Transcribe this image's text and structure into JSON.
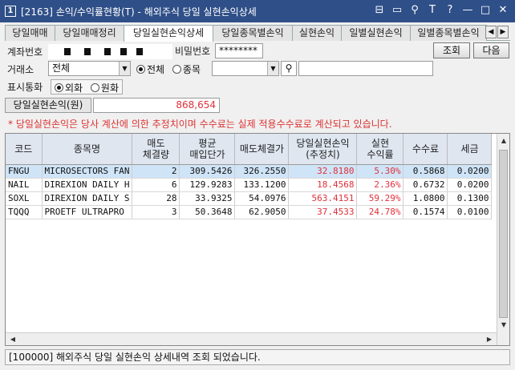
{
  "window": {
    "icon_label": "1",
    "title": "[2163] 손익/수익률현황(T) - 해외주식 당일 실현손익상세",
    "controls": [
      "⊟",
      "▭",
      "⚲",
      "T",
      "?",
      "—",
      "□",
      "✕"
    ]
  },
  "tabs": [
    {
      "label": "당일매매",
      "active": false
    },
    {
      "label": "당일매매정리",
      "active": false
    },
    {
      "label": "당일실현손익상세",
      "active": true
    },
    {
      "label": "당일종목별손익",
      "active": false
    },
    {
      "label": "실현손익",
      "active": false
    },
    {
      "label": "일별실현손익",
      "active": false
    },
    {
      "label": "일별종목별손익",
      "active": false
    }
  ],
  "form": {
    "account_label": "계좌번호",
    "password_label": "비밀번호",
    "password_value": "********",
    "query_button": "조회",
    "next_button": "다음",
    "exchange_label": "거래소",
    "exchange_value": "전체",
    "scope_all": "전체",
    "scope_item": "종목",
    "currency_label": "표시통화",
    "currency_foreign": "외화",
    "currency_won": "원화"
  },
  "summary": {
    "label": "당일실현손익(원)",
    "value": "868,654"
  },
  "notice": "* 당일실현손익은 당사 계산에 의한 추정치이며 수수료는 실제 적용수수료로 계산되고 있습니다.",
  "table": {
    "headers": [
      "코드",
      "종목명",
      "매도\n체결량",
      "평균\n매입단가",
      "매도체결가",
      "당일실현손익\n(추정치)",
      "실현\n수익률",
      "수수료",
      "세금"
    ],
    "rows": [
      {
        "code": "FNGU",
        "name": "MICROSECTORS FAN",
        "qty": "2",
        "avg": "309.5426",
        "sell": "326.2550",
        "pnl": "32.8180",
        "rate": "5.30%",
        "fee": "0.5868",
        "tax": "0.0200"
      },
      {
        "code": "NAIL",
        "name": "DIREXION DAILY H",
        "qty": "6",
        "avg": "129.9283",
        "sell": "133.1200",
        "pnl": "18.4568",
        "rate": "2.36%",
        "fee": "0.6732",
        "tax": "0.0200"
      },
      {
        "code": "SOXL",
        "name": "DIREXION DAILY S",
        "qty": "28",
        "avg": "33.9325",
        "sell": "54.0976",
        "pnl": "563.4151",
        "rate": "59.29%",
        "fee": "1.0800",
        "tax": "0.1300"
      },
      {
        "code": "TQQQ",
        "name": "PROETF ULTRAPRO",
        "qty": "3",
        "avg": "50.3648",
        "sell": "62.9050",
        "pnl": "37.4533",
        "rate": "24.78%",
        "fee": "0.1574",
        "tax": "0.0100"
      }
    ]
  },
  "status": "[100000] 해외주식 당일 실현손익 상세내역 조회 되었습니다.",
  "colors": {
    "titlebar": "#2f4f88",
    "profit": "#e0303a",
    "selected_row": "#cfe4f7",
    "header_bg": "#dfe6f0"
  }
}
